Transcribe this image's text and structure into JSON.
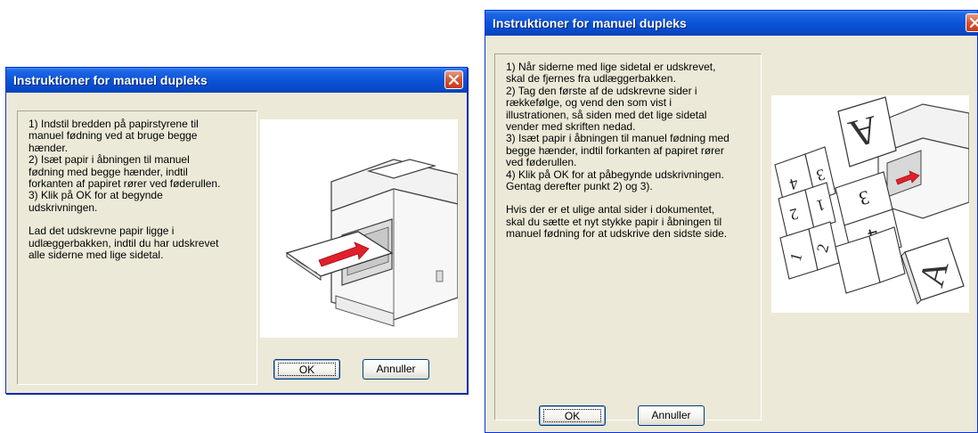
{
  "colors": {
    "dialog_bg": "#ece9d8",
    "titlebar": "#0a55d8",
    "close_button": "#d8583a",
    "arrow_red": "#e0202a"
  },
  "left_dialog": {
    "title": "Instruktioner for manuel dupleks",
    "paragraph_1": "1) Indstil bredden på papirstyrene til\nmanuel fødning ved at bruge begge\nhænder.\n2) Isæt papir i åbningen til manuel\nfødning med begge hænder, indtil\nforkanten af papiret rører ved føderullen.\n3) Klik på OK for at begynde\nudskrivningen.",
    "paragraph_2": "Lad det udskrevne papir ligge i\nudlæggerbakken, indtil du har udskrevet\nalle siderne med lige sidetal.",
    "ok_label": "OK",
    "cancel_label": "Annuller",
    "illustration_icon": "printer-manual-feed"
  },
  "right_dialog": {
    "title": "Instruktioner for manuel dupleks",
    "paragraph_1": "1) Når siderne med lige sidetal er udskrevet,\nskal de fjernes fra udlæggerbakken.\n2) Tag den første af de udskrevne sider i\nrækkefølge, og vend den som vist i\nillustrationen, så siden med det lige sidetal\nvender med skriften nedad.\n3) Isæt papir i åbningen til manuel fødning med\nbegge hænder, indtil forkanten af papiret rører\nved føderullen.\n4) Klik på OK for at påbegynde udskrivningen.\nGentag derefter punkt 2) og 3).",
    "paragraph_2": "  Hvis der er et ulige antal sider i dokumentet,\nskal du sætte et nyt stykke papir i åbningen til\nmanuel fødning for at udskrive den sidste side.",
    "ok_label": "OK",
    "cancel_label": "Annuller",
    "illustration_icon": "duplex-page-order",
    "page_numbers": [
      "4",
      "3",
      "2",
      "1",
      "3",
      "4",
      "1",
      "2"
    ],
    "page_letter": "A"
  }
}
